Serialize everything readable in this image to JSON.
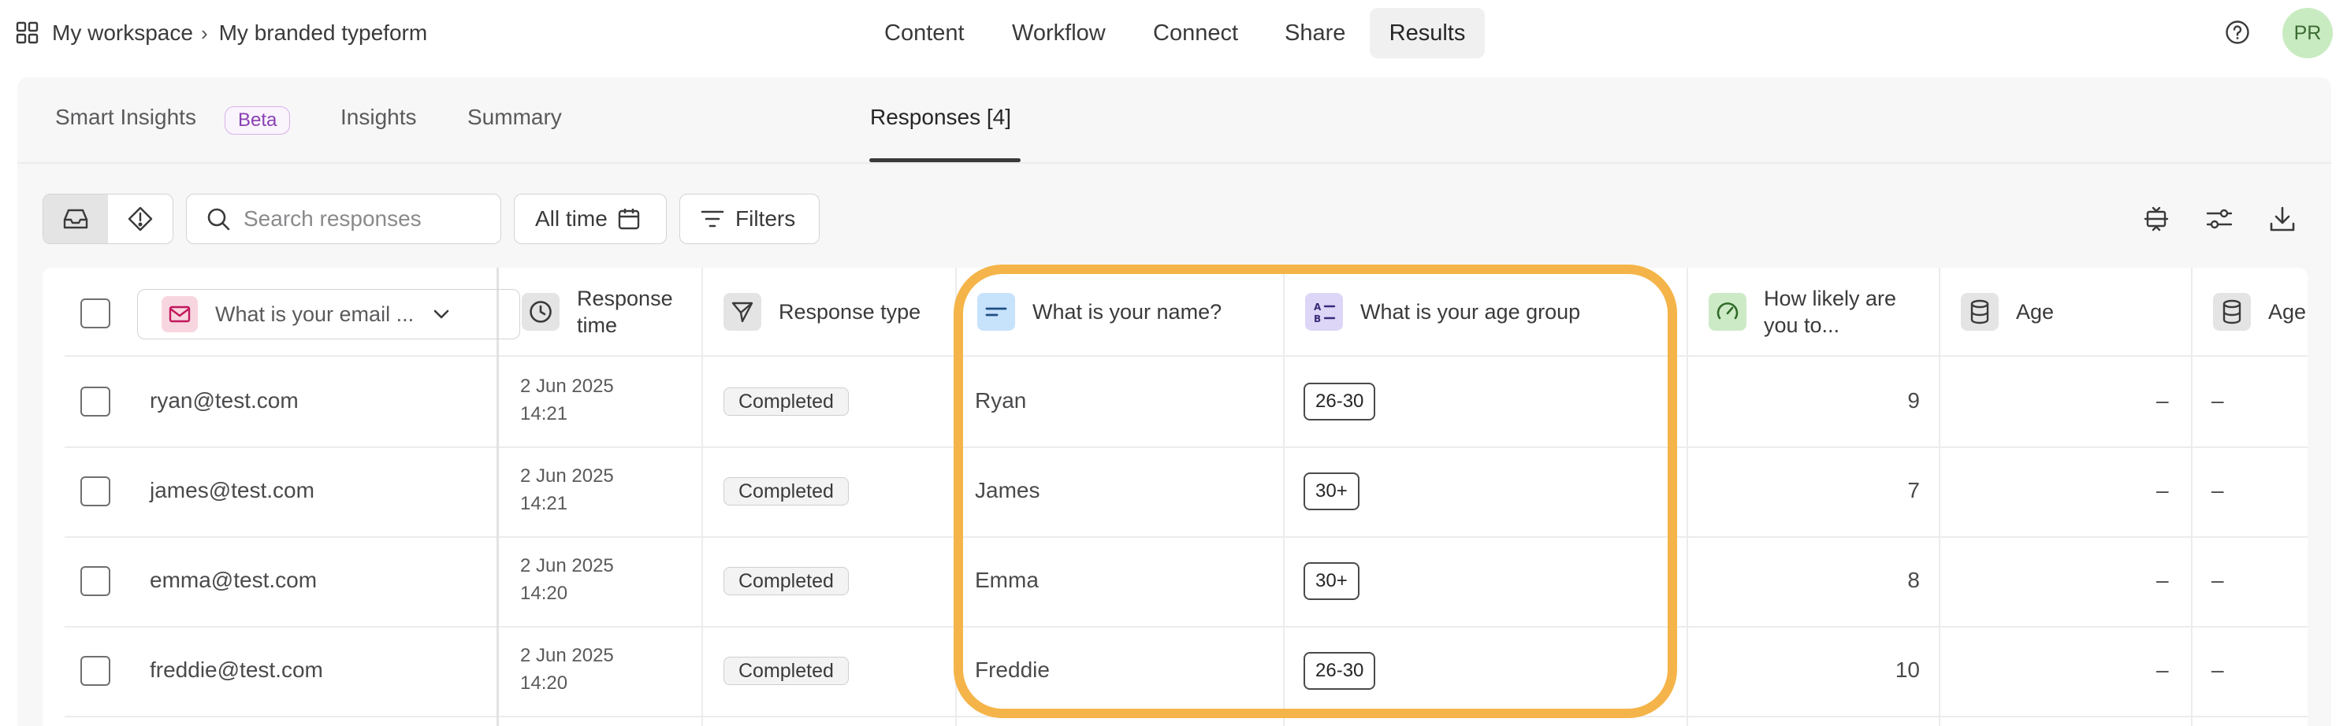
{
  "breadcrumb": {
    "workspace": "My workspace",
    "form": "My branded typeform"
  },
  "nav": [
    "Content",
    "Workflow",
    "Connect",
    "Share",
    "Results"
  ],
  "user": {
    "initials": "PR"
  },
  "tabs": {
    "smart_insights": "Smart Insights",
    "beta": "Beta",
    "insights": "Insights",
    "summary": "Summary",
    "responses": "Responses [4]"
  },
  "toolbar": {
    "search_placeholder": "Search responses",
    "time_filter": "All time",
    "filters": "Filters"
  },
  "columns": {
    "email": "What is your email ...",
    "response_time": "Response time",
    "response_type": "Response type",
    "name": "What is your name?",
    "age_group": "What is your age group",
    "likely": "How likely are you to...",
    "age1": "Age",
    "age2": "Age"
  },
  "rows": [
    {
      "email": "ryan@test.com",
      "date": "2 Jun 2025",
      "time": "14:21",
      "type": "Completed",
      "name": "Ryan",
      "age_group": "26-30",
      "likely": "9",
      "age1": "–",
      "age2": "–"
    },
    {
      "email": "james@test.com",
      "date": "2 Jun 2025",
      "time": "14:21",
      "type": "Completed",
      "name": "James",
      "age_group": "30+",
      "likely": "7",
      "age1": "–",
      "age2": "–"
    },
    {
      "email": "emma@test.com",
      "date": "2 Jun 2025",
      "time": "14:20",
      "type": "Completed",
      "name": "Emma",
      "age_group": "30+",
      "likely": "8",
      "age1": "–",
      "age2": "–"
    },
    {
      "email": "freddie@test.com",
      "date": "2 Jun 2025",
      "time": "14:20",
      "type": "Completed",
      "name": "Freddie",
      "age_group": "26-30",
      "likely": "10",
      "age1": "–",
      "age2": "–"
    }
  ],
  "colors": {
    "highlight": "#f5b449",
    "beta": "#8a40b3",
    "avatar_bg": "#c9ebc1"
  }
}
